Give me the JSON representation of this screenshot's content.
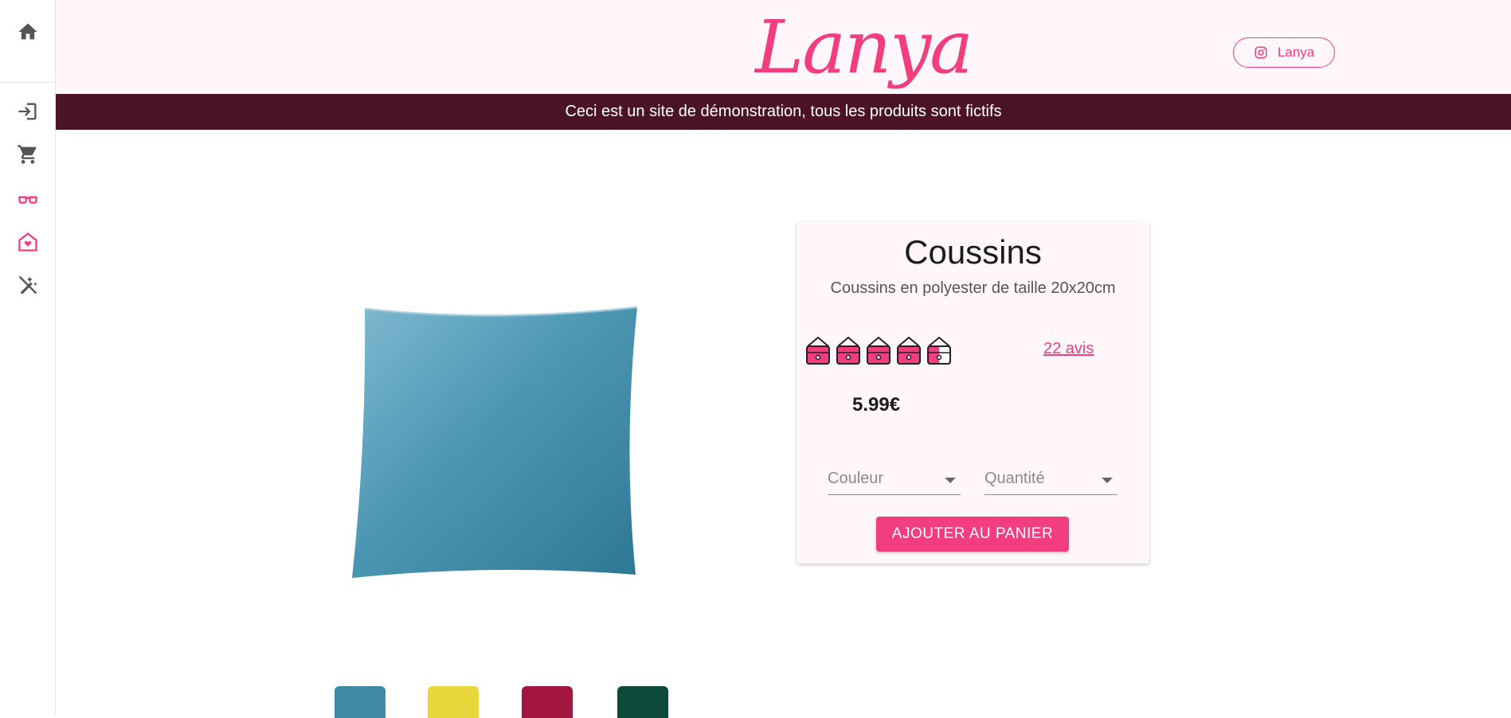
{
  "brand": {
    "logo": "Lanya",
    "instagram_label": "Lanya"
  },
  "banner": {
    "text": "Ceci est un site de démonstration, tous les produits sont fictifs"
  },
  "sidebar": {
    "items": [
      {
        "icon": "home-icon"
      },
      {
        "icon": "login-icon"
      },
      {
        "icon": "cart-icon"
      },
      {
        "icon": "glasses-icon",
        "active": true
      },
      {
        "icon": "house-heart-icon",
        "active": true
      },
      {
        "icon": "magic-off-icon"
      }
    ]
  },
  "product": {
    "title": "Coussins",
    "description": "Coussins en polyester de taille 20x20cm",
    "rating": 4.5,
    "rating_max": 5,
    "reviews_label": "22 avis",
    "price": "5.99€",
    "color_select_label": "Couleur",
    "quantity_select_label": "Quantité",
    "add_to_cart_label": "AJOUTER AU PANIER",
    "thumbnails": [
      {
        "color": "#3f8aa6"
      },
      {
        "color": "#e8d63a"
      },
      {
        "color": "#a3163f"
      },
      {
        "color": "#0e4a3c"
      }
    ]
  },
  "colors": {
    "accent": "#f23d7f",
    "banner_bg": "#4a1426",
    "header_bg": "#fff7f9"
  }
}
